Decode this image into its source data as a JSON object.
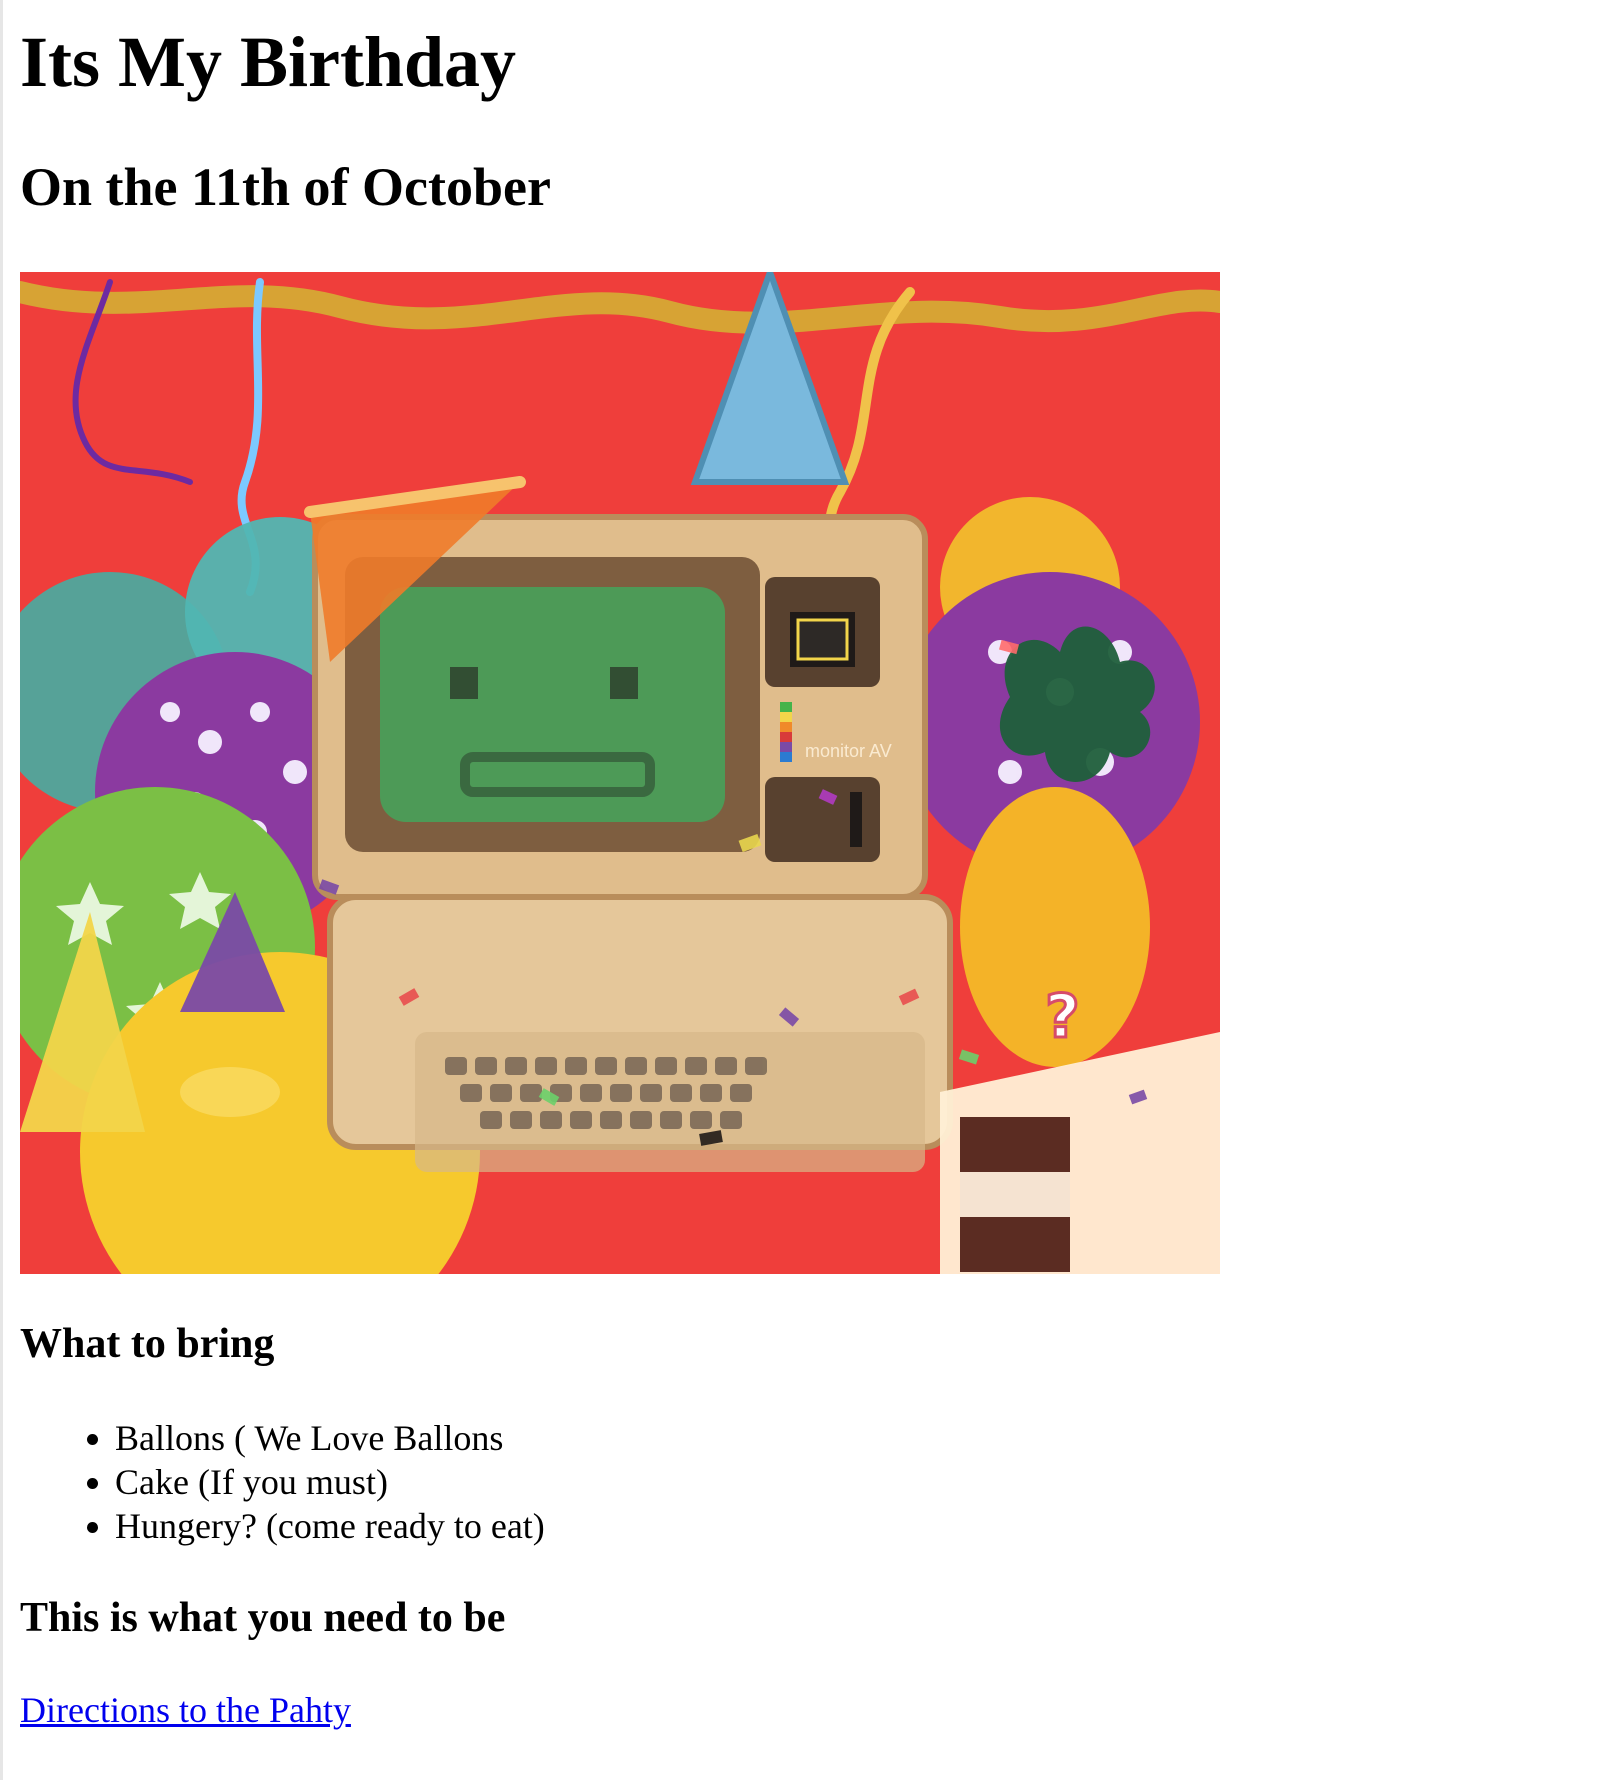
{
  "page": {
    "title": "Its My Birthday",
    "subtitle": "On the 11th of October",
    "hero_image": {
      "screen_text": "monitor AV",
      "candle_text": "?"
    },
    "sections": {
      "bring_heading": "What to bring",
      "bring_items": [
        "Ballons ( We Love Ballons",
        "Cake (If you must)",
        "Hungery? (come ready to eat)"
      ],
      "need_heading": "This is what you need to be",
      "link_text": "Directions to the Pahty"
    }
  }
}
